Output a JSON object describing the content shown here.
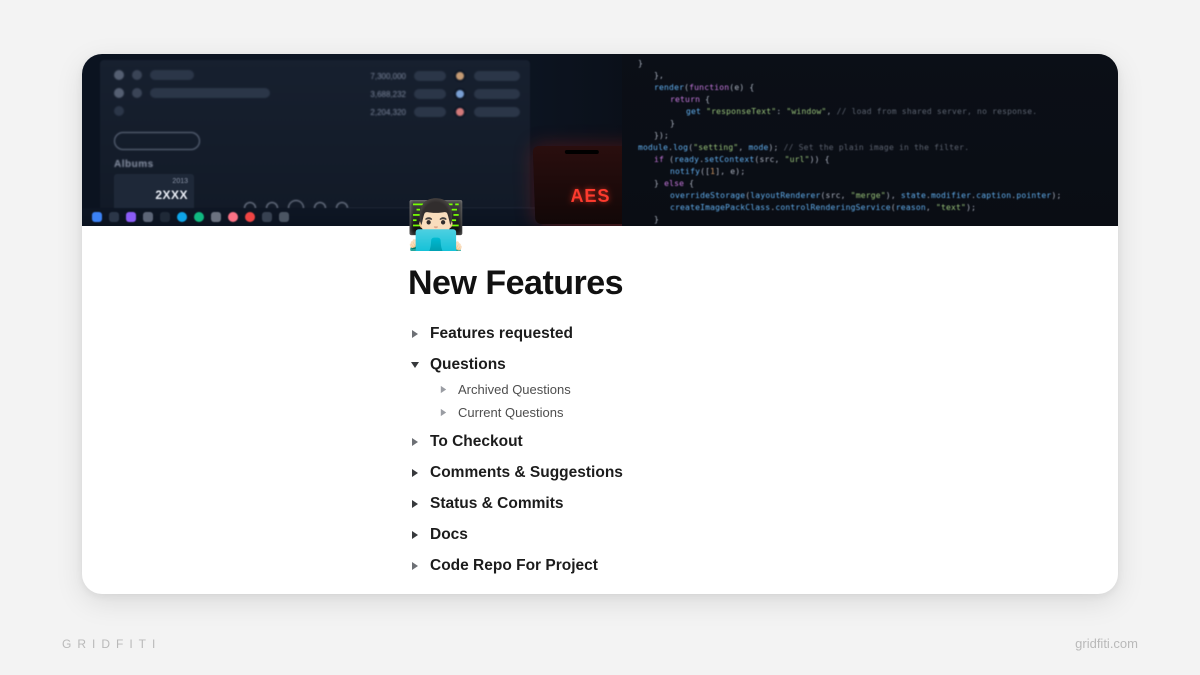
{
  "page": {
    "icon": "👨🏻‍💻",
    "title": "New Features"
  },
  "toggles": [
    {
      "label": "Features requested",
      "expanded": false
    },
    {
      "label": "Questions",
      "expanded": true,
      "children": [
        {
          "label": "Archived Questions"
        },
        {
          "label": "Current Questions"
        }
      ]
    },
    {
      "label": "To Checkout",
      "expanded": false
    },
    {
      "label": "Comments & Suggestions",
      "expanded": false
    },
    {
      "label": "Status & Commits",
      "expanded": false
    },
    {
      "label": "Docs",
      "expanded": false
    },
    {
      "label": "Code Repo For Project",
      "expanded": false
    }
  ],
  "cover": {
    "album_year": "2013",
    "album_title": "2XXX",
    "albums_heading": "Albums",
    "phone_logo": "AES"
  },
  "footer": {
    "brand_left": "GRIDFITI",
    "brand_right": "gridfiti.com"
  }
}
